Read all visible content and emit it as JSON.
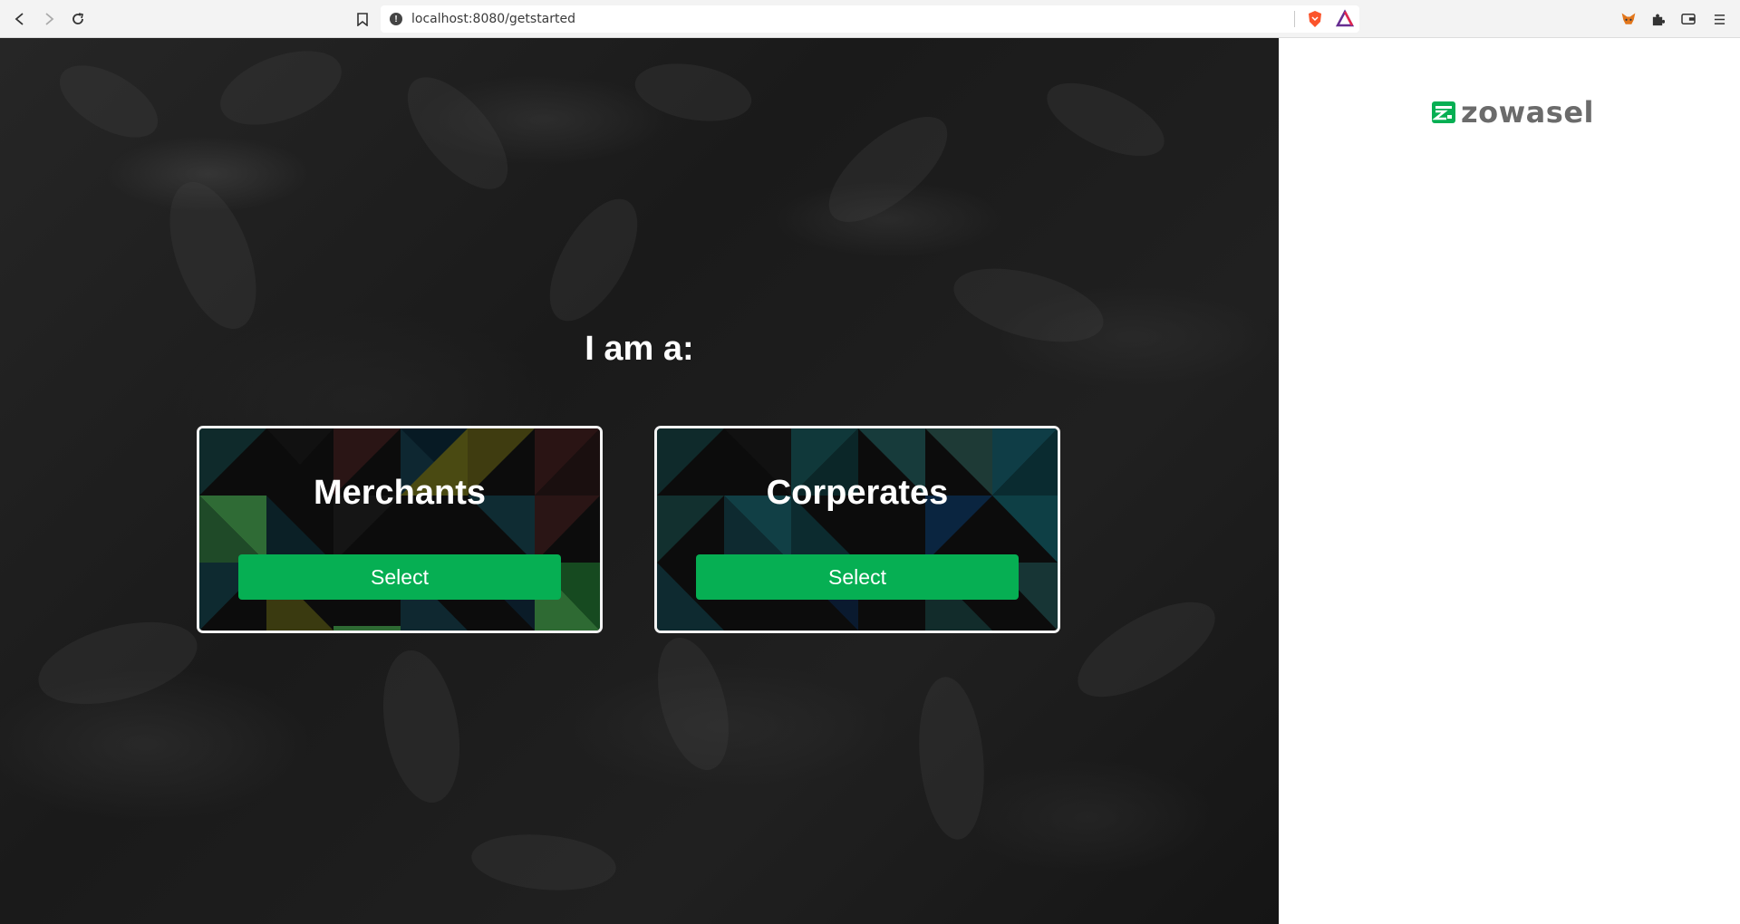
{
  "browser": {
    "url": "localhost:8080/getstarted",
    "url_info_icon": "info-icon",
    "back_icon": "back-icon",
    "forward_icon": "forward-icon",
    "reload_icon": "reload-icon",
    "bookmark_icon": "bookmark-icon",
    "shield_icon": "brave-shield-icon",
    "rewards_icon": "brave-rewards-icon",
    "extensions": [
      "metamask-fox-icon",
      "puzzle-extensions-icon",
      "wallet-icon",
      "menu-icon"
    ]
  },
  "page": {
    "prompt": "I am a:",
    "options": [
      {
        "label": "Merchants",
        "button": "Select"
      },
      {
        "label": "Corperates",
        "button": "Select"
      }
    ]
  },
  "brand": {
    "name": "zowasel",
    "primary_color": "#06af53",
    "text_color": "#6b6b6b"
  }
}
